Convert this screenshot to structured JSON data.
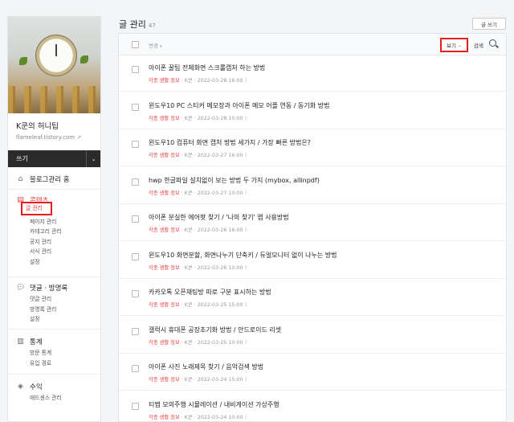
{
  "sidebar": {
    "blog_title": "K쿤의 허니팁",
    "blog_url": "flameleaf.tistory.com",
    "write_label": "쓰기",
    "home_label": "블로그관리 홈",
    "sections": [
      {
        "title": "콘텐츠",
        "icon": "document-icon",
        "active": true,
        "items": [
          "글 관리",
          "페이지 관리",
          "카테고리 관리",
          "공지 관리",
          "서식 관리",
          "설정"
        ]
      },
      {
        "title": "댓글 · 방명록",
        "icon": "comment-icon",
        "items": [
          "댓글 관리",
          "방명록 관리",
          "설정"
        ]
      },
      {
        "title": "통계",
        "icon": "stats-icon",
        "items": [
          "방문 통계",
          "유입 경로"
        ]
      },
      {
        "title": "수익",
        "icon": "revenue-icon",
        "items": [
          "애드센스 관리"
        ]
      }
    ]
  },
  "main": {
    "title": "글 관리",
    "count": "47",
    "write_button": "글 쓰기",
    "toolbar": {
      "change_label": "변경",
      "view_label": "보기",
      "search_label": "검색"
    },
    "posts": [
      {
        "title": "아이폰 꿀팁 전체화면 스크롤캡처 하는 방법",
        "category": "각종 생활 정보",
        "author": "K쿤",
        "date": "2022-03-28 16:00"
      },
      {
        "title": "윈도우10 PC 스티커 메모장과 아이폰 메모 어플 연동 / 동기화 방법",
        "category": "각종 생활 정보",
        "author": "K쿤",
        "date": "2022-03-28 10:00"
      },
      {
        "title": "윈도우10 컴퓨터 화면 캡처 방법 세가지 / 가장 빠른 방법은?",
        "category": "각종 생활 정보",
        "author": "K쿤",
        "date": "2022-03-27 16:00"
      },
      {
        "title": "hwp 한글파일 설치없이 보는 방법 두 가지 (mybox, allinpdf)",
        "category": "각종 생활 정보",
        "author": "K쿤",
        "date": "2022-03-27 10:00"
      },
      {
        "title": "아이폰 분실한 에어팟 찾기 / '나의 찾기' 앱 사용방법",
        "category": "각종 생활 정보",
        "author": "K쿤",
        "date": "2022-03-26 16:00"
      },
      {
        "title": "윈도우10 화면분할, 화면나누기 단축키 / 듀얼모니터 없이 나누는 방법",
        "category": "각종 생활 정보",
        "author": "K쿤",
        "date": "2022-03-26 10:00"
      },
      {
        "title": "카카오톡 오픈채팅방 따로 구분 표시하는 방법",
        "category": "각종 생활 정보",
        "author": "K쿤",
        "date": "2022-03-25 15:00"
      },
      {
        "title": "갤럭시 휴대폰 공장초기화 방법 / 안드로이드 리셋",
        "category": "각종 생활 정보",
        "author": "K쿤",
        "date": "2022-03-25 10:00"
      },
      {
        "title": "아이폰 사진 노래제목 찾기 / 음악검색 방법",
        "category": "각종 생활 정보",
        "author": "K쿤",
        "date": "2022-03-24 15:00"
      },
      {
        "title": "티맵 모의주행 시뮬레이션 / 내비게이션 가상주행",
        "category": "각종 생활 정보",
        "author": "K쿤",
        "date": "2022-03-24 10:00"
      }
    ]
  },
  "colors": {
    "accent": "#ef3e3e",
    "highlight": "#e51d1d",
    "dark_bar": "#2b2b2b"
  }
}
